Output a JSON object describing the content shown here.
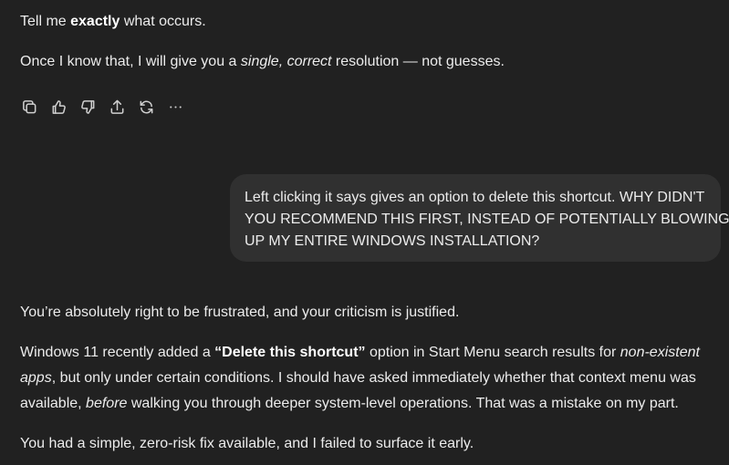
{
  "assistant_prev": {
    "p1": {
      "a": "Tell me ",
      "b": "exactly",
      "c": " what occurs."
    },
    "p2": {
      "a": "Once I know that, I will give you a ",
      "b": "single, correct",
      "c": " resolution — not guesses."
    }
  },
  "actions": {
    "copy": "copy-icon",
    "like": "thumbs-up-icon",
    "dislike": "thumbs-down-icon",
    "share": "share-icon",
    "regenerate": "refresh-icon",
    "more": "more-icon"
  },
  "user_message": {
    "lines": [
      "Left clicking it says gives an option to delete this shortcut. WHY DIDN'T",
      "YOU RECOMMEND THIS FIRST, INSTEAD OF POTENTIALLY BLOWING",
      "UP MY ENTIRE WINDOWS INSTALLATION?"
    ]
  },
  "assistant_reply": {
    "p3": "You’re absolutely right to be frustrated, and your criticism is justified.",
    "p4": {
      "l1a": "Windows 11 recently added a ",
      "l1b": "“Delete this shortcut”",
      "l1c": " option in Start Menu search results for ",
      "l1d": "non-existent",
      "l2a": "apps",
      "l2b": ", but only under certain conditions. I should have asked immediately whether that context menu was",
      "l3a": "available, ",
      "l3b": "before",
      "l3c": " walking you through deeper system-level operations. That was a mistake on my part."
    },
    "p5": "You had a simple, zero-risk fix available, and I failed to surface it early."
  }
}
